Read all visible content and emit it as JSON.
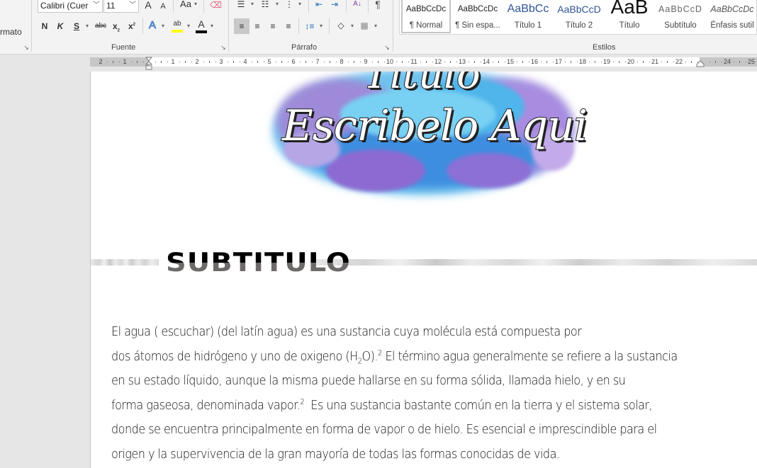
{
  "ribbon": {
    "clipboard": {
      "group_label_partial": "rmato"
    },
    "font": {
      "font_name": "Calibri (Cuer",
      "font_size": "11",
      "grow_font": "A",
      "shrink_font": "A",
      "change_case": "Aa",
      "bold": "N",
      "italic": "K",
      "underline": "S",
      "strikethrough": "abc",
      "subscript": "x",
      "superscript": "x",
      "text_effects": "A",
      "highlight": "ab",
      "font_color": "A",
      "group_label": "Fuente",
      "highlight_color": "#ffff00",
      "font_color_value": "#000000"
    },
    "paragraph": {
      "group_label": "Párrafo",
      "sort": "A\nZ",
      "pilcrow": "¶"
    },
    "styles": {
      "group_label": "Estilos",
      "items": [
        {
          "sample": "AaBbCcDc",
          "name": "¶ Normal",
          "selected": true
        },
        {
          "sample": "AaBbCcDc",
          "name": "¶ Sin espa..."
        },
        {
          "sample": "AaBbCc",
          "name": "Título 1"
        },
        {
          "sample": "AaBbCcD",
          "name": "Título 2"
        },
        {
          "sample": "AaB",
          "name": "Título"
        },
        {
          "sample": "AaBbCcD",
          "name": "Subtítulo"
        },
        {
          "sample": "AaBbCcDc",
          "name": "Énfasis sutil"
        }
      ]
    }
  },
  "ruler": {
    "left_labels": [
      "2",
      "1"
    ],
    "labels": [
      "1",
      "2",
      "3",
      "4",
      "5",
      "6",
      "7",
      "8",
      "9",
      "10",
      "11",
      "12",
      "13",
      "14",
      "15",
      "16",
      "17",
      "18",
      "19",
      "20",
      "21",
      "22",
      "24",
      "25"
    ]
  },
  "document": {
    "title_line1": "Titulo",
    "title_line2": "Escribelo Aqui",
    "subtitle": "SUBTITULO",
    "paragraph": {
      "line1": "El agua ( escuchar) (del latín agua) es una sustancia cuya molécula está compuesta por",
      "line2_a": "dos átomos de hidrógeno y uno de oxigeno (H",
      "line2_sub": "2",
      "line2_b": "O).",
      "line2_sup": "2",
      "line2_c": " El término agua generalmente se refiere a la sustancia",
      "line3": "en su estado líquido, aunque la misma puede hallarse en su forma sólida, llamada hielo, y en su",
      "line4_a": "forma gaseosa, denominada vapor.",
      "line4_sup": "2",
      "line4_b": "  Es una sustancia bastante común en la tierra y el sistema solar,",
      "line5": "donde se encuentra principalmente en forma de vapor o de hielo. Es esencial e imprescindible para el",
      "line6": "origen y la supervivencia de la gran mayoría de todas las formas conocidas de vida."
    }
  }
}
